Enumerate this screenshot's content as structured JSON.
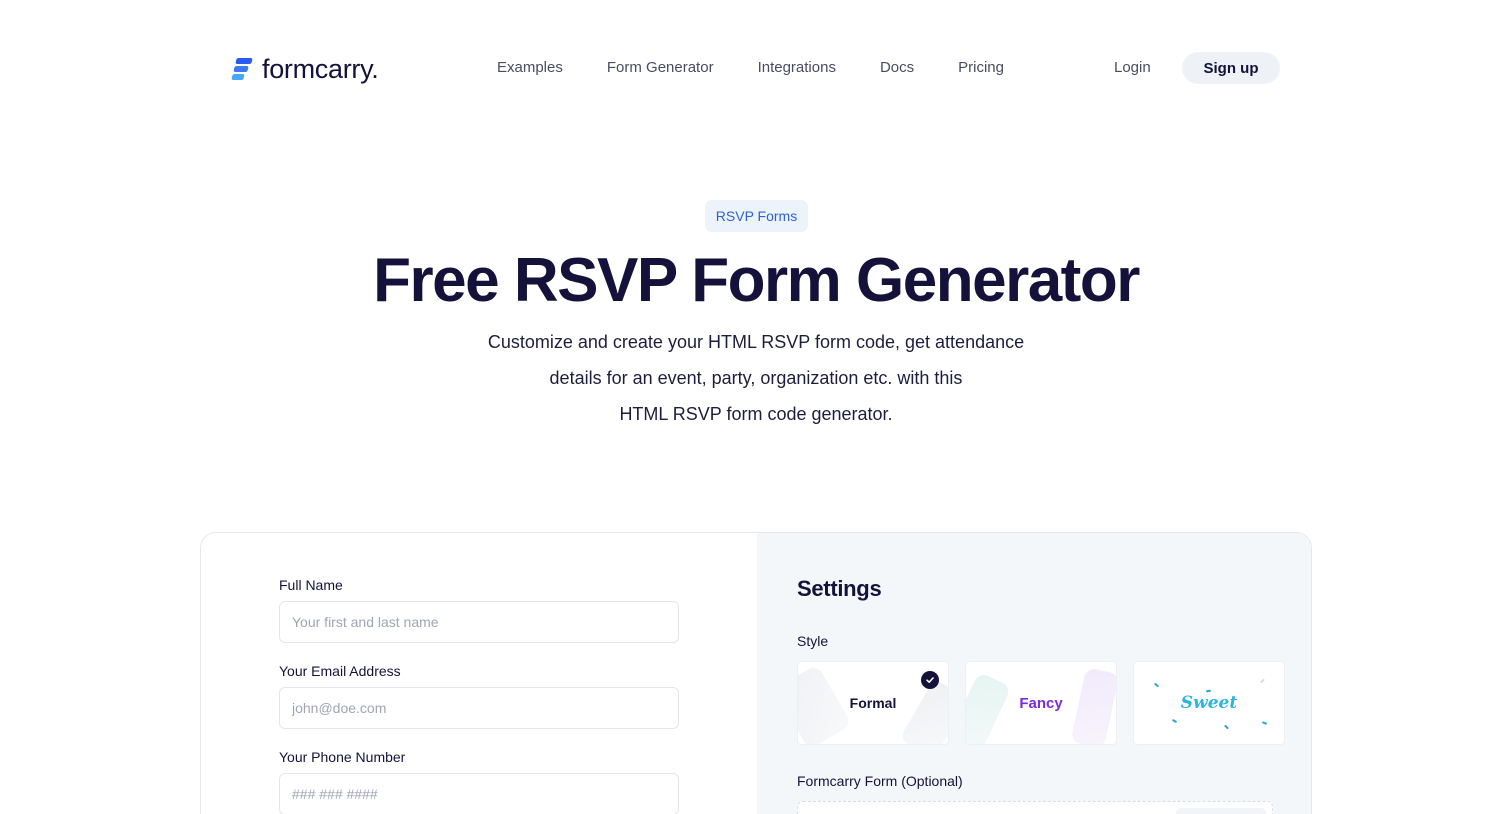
{
  "nav": {
    "logo": "formcarry.",
    "links": [
      "Examples",
      "Form Generator",
      "Integrations",
      "Docs",
      "Pricing"
    ],
    "login": "Login",
    "signup": "Sign up"
  },
  "hero": {
    "badge": "RSVP Forms",
    "title": "Free RSVP Form Generator",
    "subtitle_lines": [
      "Customize and create your HTML RSVP form code, get attendance",
      "details for an event, party, organization etc. with this",
      "HTML RSVP form code generator."
    ]
  },
  "form": {
    "fields": [
      {
        "label": "Full Name",
        "placeholder": "Your first and last name"
      },
      {
        "label": "Your Email Address",
        "placeholder": "john@doe.com"
      },
      {
        "label": "Your Phone Number",
        "placeholder": "### ### ####"
      }
    ]
  },
  "settings": {
    "title": "Settings",
    "style_label": "Style",
    "styles": [
      {
        "label": "Formal",
        "selected": true
      },
      {
        "label": "Fancy",
        "selected": false
      },
      {
        "label": "Sweet",
        "selected": false
      }
    ],
    "formcarry_label": "Formcarry Form (Optional)"
  },
  "colors": {
    "primary": "#14123a",
    "accent_blue": "#2c62d8",
    "fancy_purple": "#7a2be0",
    "sweet_cyan": "#2ab6dc",
    "settings_bg": "#f4f7fa"
  }
}
